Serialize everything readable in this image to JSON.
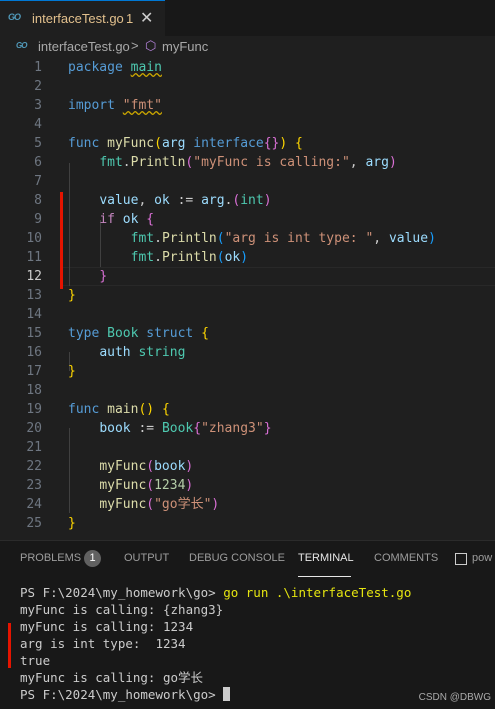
{
  "tab": {
    "icon": "go-file-icon",
    "icon_text": "GO",
    "name": "interfaceTest.go",
    "problems": "1",
    "close": "✕"
  },
  "breadcrumb": {
    "icon_text": "GO",
    "file": "interfaceTest.go",
    "separator": ">",
    "symbol": "myFunc"
  },
  "editor": {
    "line_numbers": [
      "1",
      "2",
      "3",
      "4",
      "5",
      "6",
      "7",
      "8",
      "9",
      "10",
      "11",
      "12",
      "13",
      "14",
      "15",
      "16",
      "17",
      "18",
      "19",
      "20",
      "21",
      "22",
      "23",
      "24",
      "25"
    ],
    "active_line": "12"
  },
  "panel": {
    "tabs": [
      "PROBLEMS",
      "OUTPUT",
      "DEBUG CONSOLE",
      "TERMINAL",
      "COMMENTS",
      "pow"
    ],
    "problems_count": "1",
    "terminal_lines": [
      "PS F:\\2024\\my_homework\\go> ",
      "myFunc is calling: {zhang3}",
      "myFunc is calling: 1234",
      "arg is int type:  1234",
      "true",
      "myFunc is calling: go学长",
      "PS F:\\2024\\my_homework\\go> "
    ],
    "command": "go run .\\interfaceTest.go"
  },
  "watermark": "CSDN @DBWG",
  "colors": {
    "accent": "#0078d4",
    "gutter_change": "#e51400",
    "tab_modified": "#e2c08d"
  }
}
